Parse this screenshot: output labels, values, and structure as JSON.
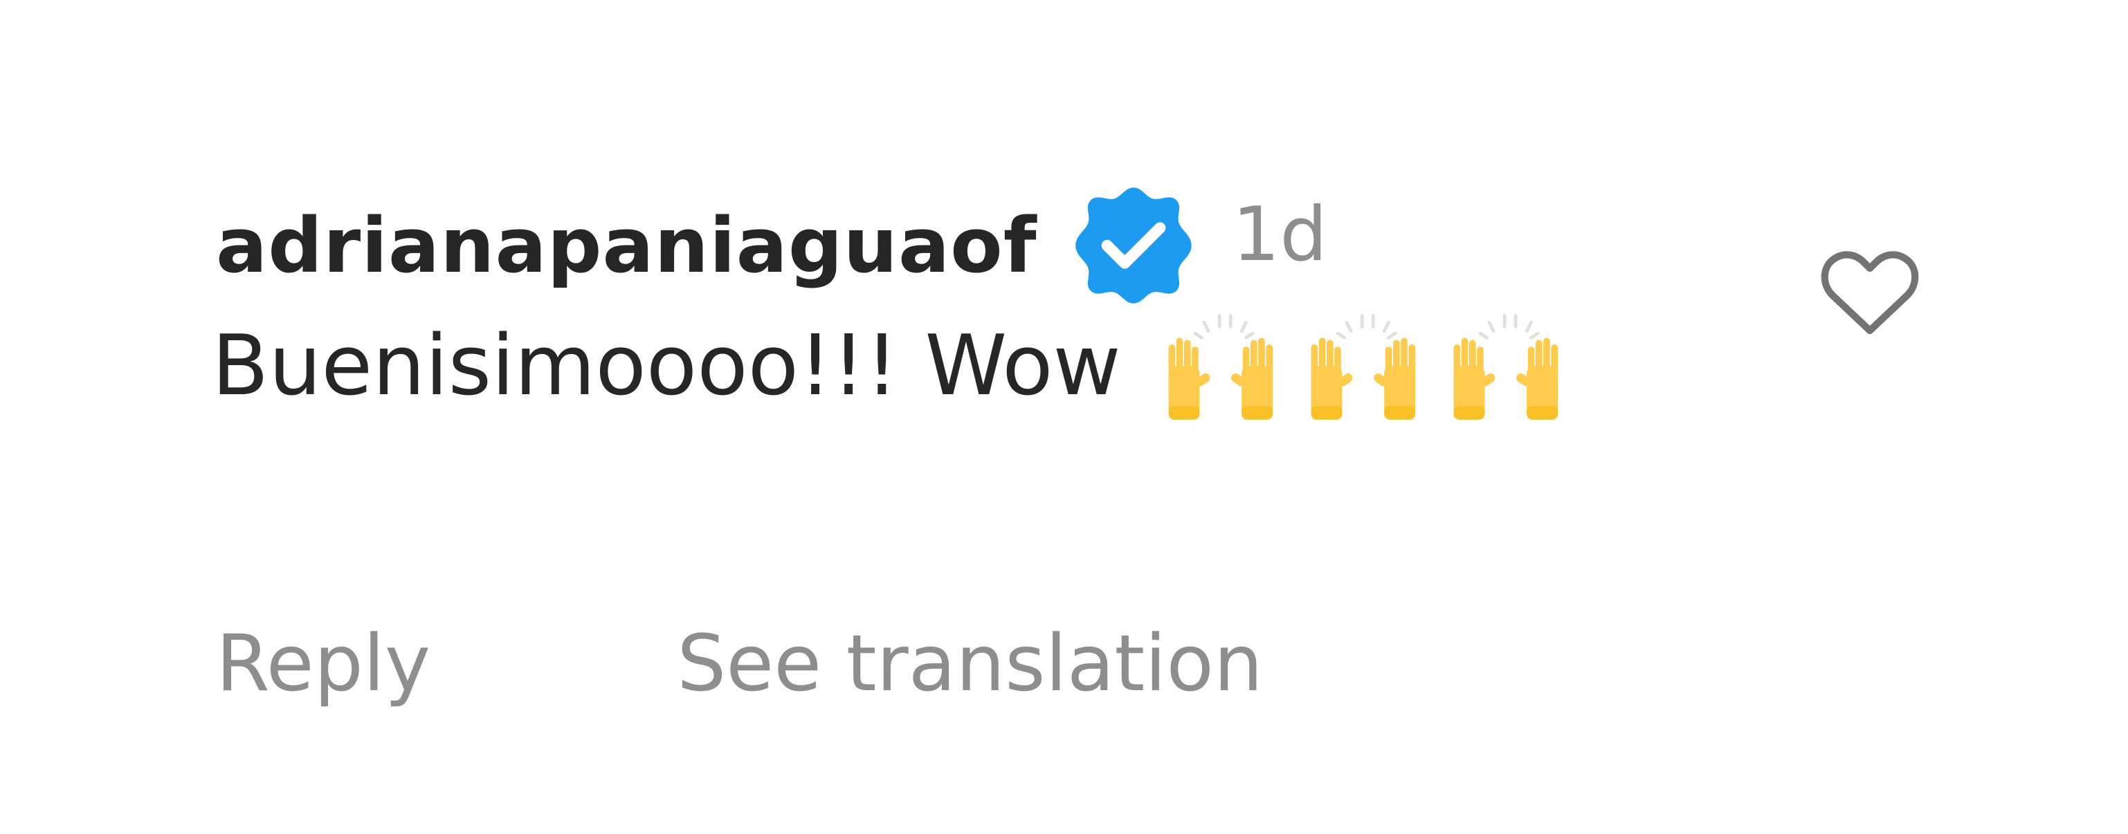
{
  "comment": {
    "username": "adrianapaniaguaof",
    "verified": true,
    "timestamp": "1d",
    "text": "Buenisimoooo!!! Wow",
    "emoji_icons": [
      "raising-hands-emoji",
      "raising-hands-emoji",
      "raising-hands-emoji"
    ]
  },
  "actions": {
    "reply_label": "Reply",
    "translation_label": "See translation"
  },
  "icons": {
    "verified": "verified-badge-icon",
    "like": "heart-icon"
  },
  "colors": {
    "verified_blue": "#1d9bf0",
    "username": "#262626",
    "secondary_text": "#8e8e8e",
    "emoji_yellow": "#ffcb4c"
  }
}
